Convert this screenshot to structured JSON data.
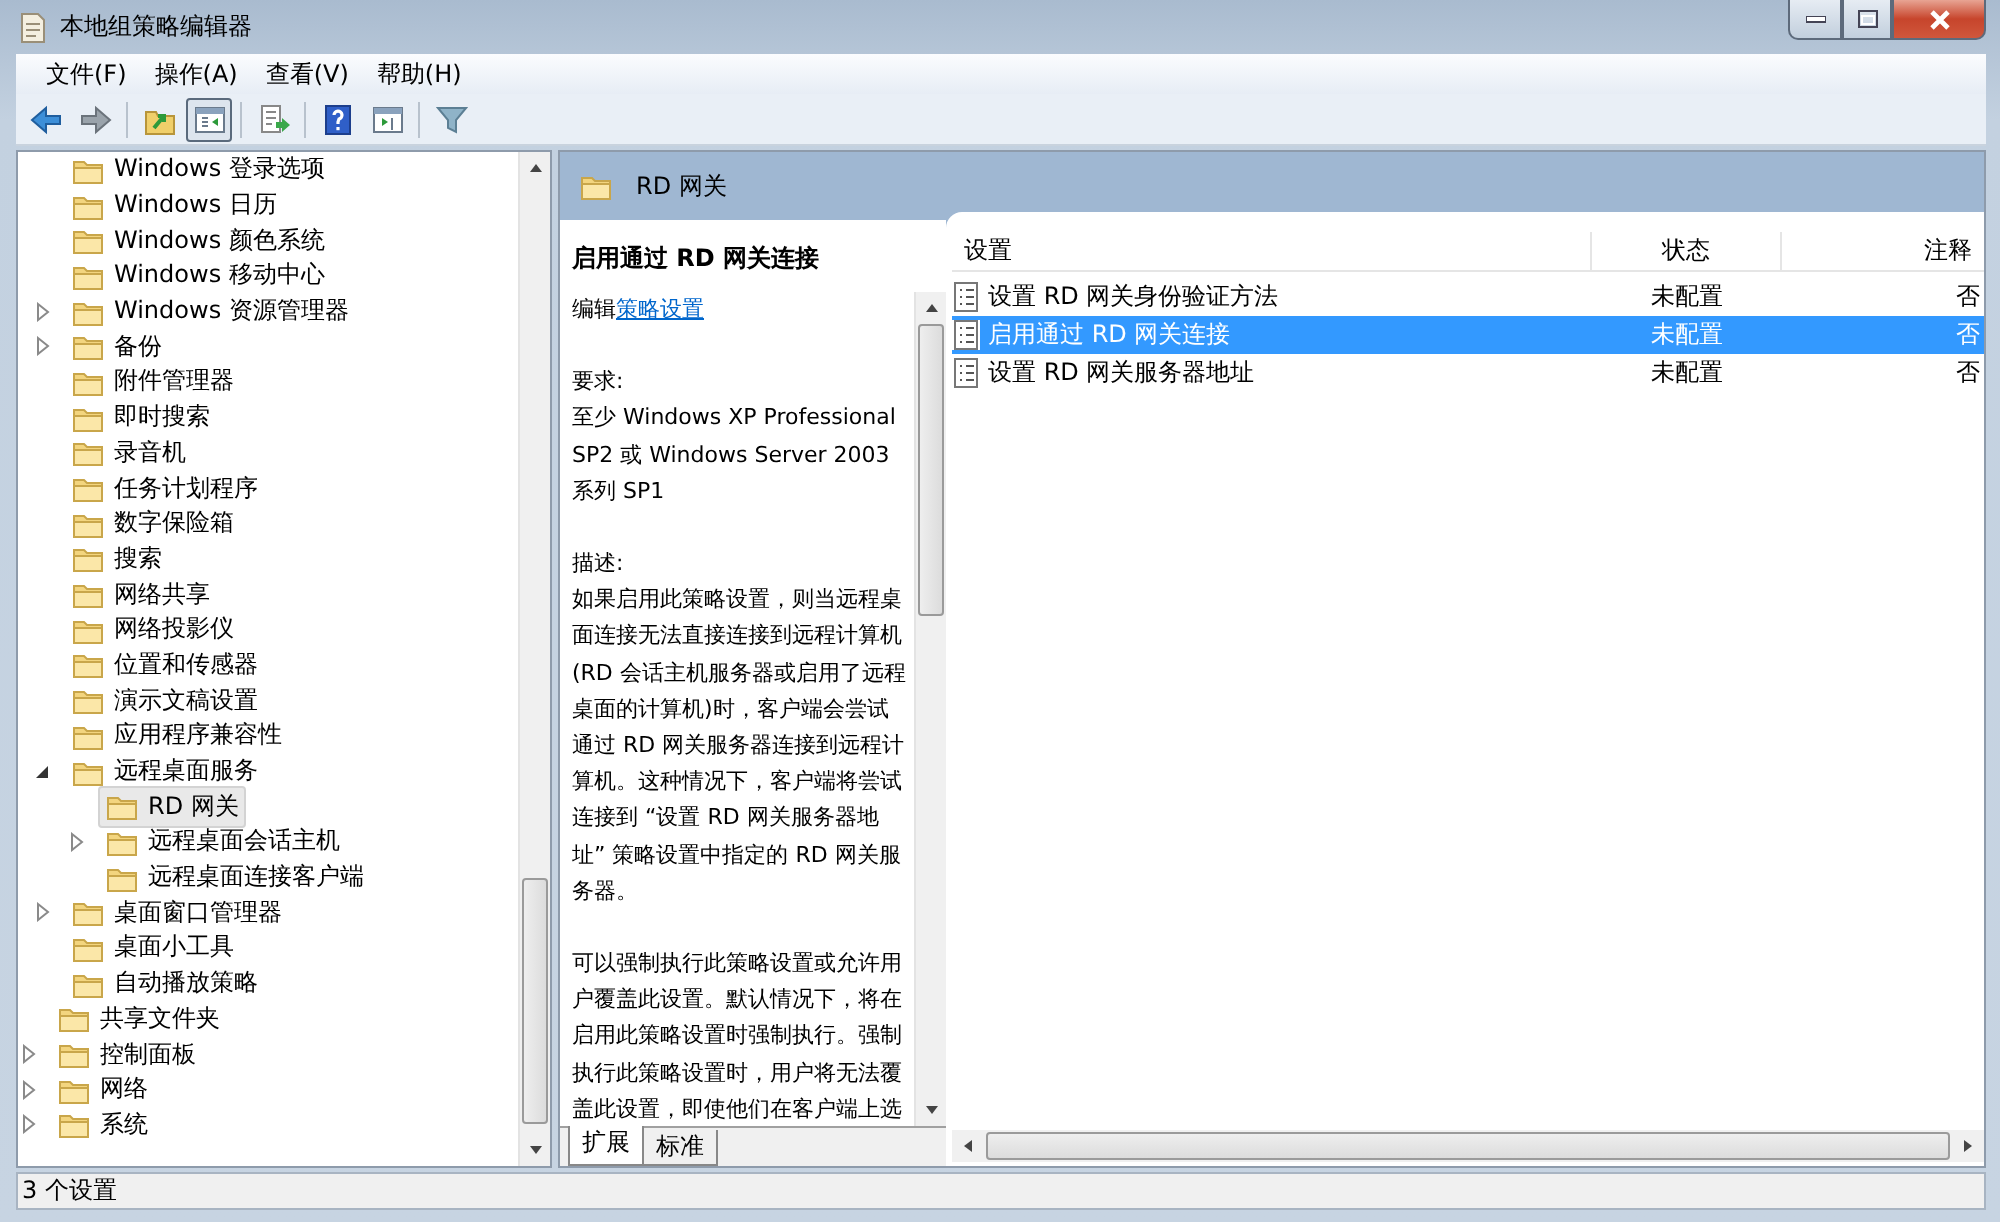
{
  "window": {
    "title": "本地组策略编辑器"
  },
  "menu": [
    "文件(F)",
    "操作(A)",
    "查看(V)",
    "帮助(H)"
  ],
  "toolbar": [
    {
      "kind": "back",
      "pressed": false
    },
    {
      "kind": "forward",
      "pressed": false
    },
    {
      "kind": "sep"
    },
    {
      "kind": "up",
      "pressed": false
    },
    {
      "kind": "tree",
      "pressed": true
    },
    {
      "kind": "sep"
    },
    {
      "kind": "export",
      "pressed": false
    },
    {
      "kind": "sep"
    },
    {
      "kind": "help",
      "pressed": false
    },
    {
      "kind": "pane",
      "pressed": false
    },
    {
      "kind": "sep"
    },
    {
      "kind": "filter",
      "pressed": false
    }
  ],
  "tree": [
    {
      "children": [
        {
          "children": [
            {
              "label": "Windows 登录选项",
              "selected": false
            },
            {
              "label": "Windows 日历",
              "selected": false
            },
            {
              "label": "Windows 颜色系统",
              "selected": false
            },
            {
              "label": "Windows 移动中心",
              "selected": false
            },
            {
              "label": "Windows 资源管理器",
              "selected": false,
              "expanded": false
            },
            {
              "label": "备份",
              "selected": false,
              "expanded": false
            },
            {
              "label": "附件管理器",
              "selected": false
            },
            {
              "label": "即时搜索",
              "selected": false
            },
            {
              "label": "录音机",
              "selected": false
            },
            {
              "label": "任务计划程序",
              "selected": false
            },
            {
              "label": "数字保险箱",
              "selected": false
            },
            {
              "label": "搜索",
              "selected": false
            },
            {
              "label": "网络共享",
              "selected": false
            },
            {
              "label": "网络投影仪",
              "selected": false
            },
            {
              "label": "位置和传感器",
              "selected": false
            },
            {
              "label": "演示文稿设置",
              "selected": false
            },
            {
              "label": "应用程序兼容性",
              "selected": false
            },
            {
              "label": "远程桌面服务",
              "selected": false,
              "expanded": true,
              "children": [
                {
                  "label": "RD 网关",
                  "selected": true
                },
                {
                  "label": "远程桌面会话主机",
                  "selected": false,
                  "expanded": false
                },
                {
                  "label": "远程桌面连接客户端",
                  "selected": false
                }
              ]
            },
            {
              "label": "桌面窗口管理器",
              "selected": false,
              "expanded": false
            },
            {
              "label": "桌面小工具",
              "selected": false
            },
            {
              "label": "自动播放策略",
              "selected": false
            }
          ]
        },
        {
          "label": "共享文件夹",
          "selected": false
        },
        {
          "label": "控制面板",
          "selected": false,
          "expanded": false
        },
        {
          "label": "网络",
          "selected": false,
          "expanded": false
        },
        {
          "label": "系统",
          "selected": false,
          "expanded": false
        }
      ]
    }
  ],
  "header": {
    "title": "RD 网关"
  },
  "description": {
    "title": "启用通过 RD 网关连接",
    "edit_prefix": "编辑",
    "edit_link": "策略设置",
    "requirements_label": "要求:",
    "requirements": "至少 Windows XP Professional SP2 或 Windows Server 2003 系列 SP1",
    "description_label": "描述:",
    "paragraphs": [
      "如果启用此策略设置，则当远程桌面连接无法直接连接到远程计算机(RD 会话主机服务器或启用了远程桌面的计算机)时，客户端会尝试通过 RD 网关服务器连接到远程计算机。这种情况下，客户端将尝试连接到 “设置 RD 网关服务器地址” 策略设置中指定的 RD 网关服务器。",
      "可以强制执行此策略设置或允许用户覆盖此设置。默认情况下，将在启用此策略设置时强制执行。强制执行此策略设置时，用户将无法覆盖此设置，即使他们在客户端上选"
    ]
  },
  "list": {
    "columns": [
      "设置",
      "状态",
      "注释"
    ],
    "rows": [
      {
        "cells": [
          "设置 RD 网关身份验证方法",
          "未配置",
          "否"
        ],
        "selected": false
      },
      {
        "cells": [
          "启用通过 RD 网关连接",
          "未配置",
          "否"
        ],
        "selected": true
      },
      {
        "cells": [
          "设置 RD 网关服务器地址",
          "未配置",
          "否"
        ],
        "selected": false
      }
    ]
  },
  "tabs": [
    {
      "label": "扩展",
      "selected": true
    },
    {
      "label": "标准",
      "selected": false
    }
  ],
  "status_bar": {
    "text": "3 个设置"
  }
}
